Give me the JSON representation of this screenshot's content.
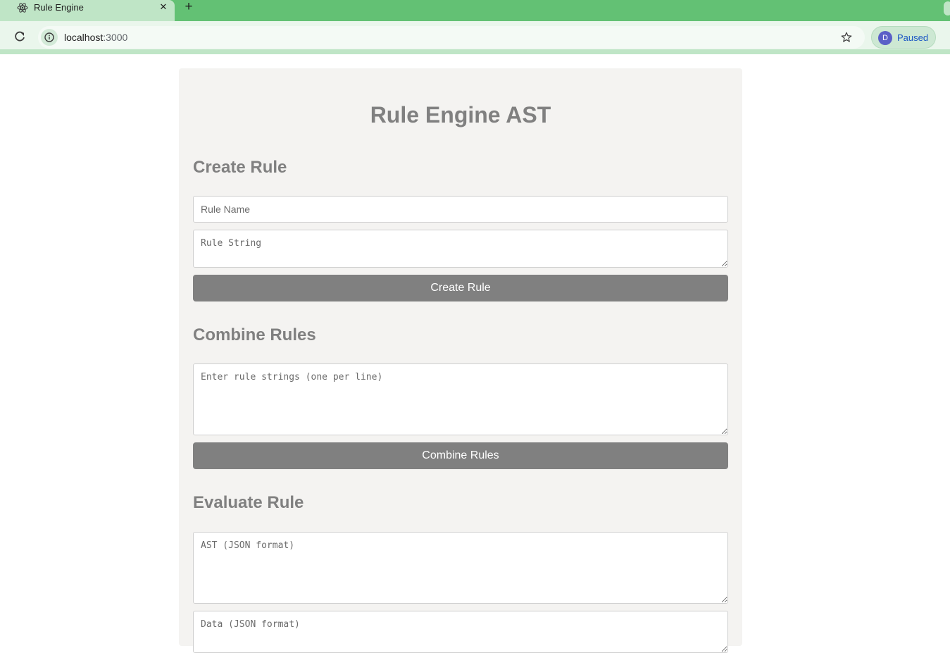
{
  "browser": {
    "tab_title": "Rule Engine",
    "url_host": "localhost",
    "url_port": ":3000",
    "profile_initial": "D",
    "profile_status": "Paused"
  },
  "page": {
    "title": "Rule Engine AST",
    "create_rule": {
      "heading": "Create Rule",
      "name_placeholder": "Rule Name",
      "string_placeholder": "Rule String",
      "button": "Create Rule"
    },
    "combine_rules": {
      "heading": "Combine Rules",
      "rules_placeholder": "Enter rule strings (one per line)",
      "button": "Combine Rules"
    },
    "evaluate_rule": {
      "heading": "Evaluate Rule",
      "ast_placeholder": "AST (JSON format)",
      "data_placeholder": "Data (JSON format)"
    }
  },
  "colors": {
    "tabstrip": "#63c174",
    "button": "#808080",
    "heading": "#808080",
    "panel": "#f4f3f1"
  }
}
